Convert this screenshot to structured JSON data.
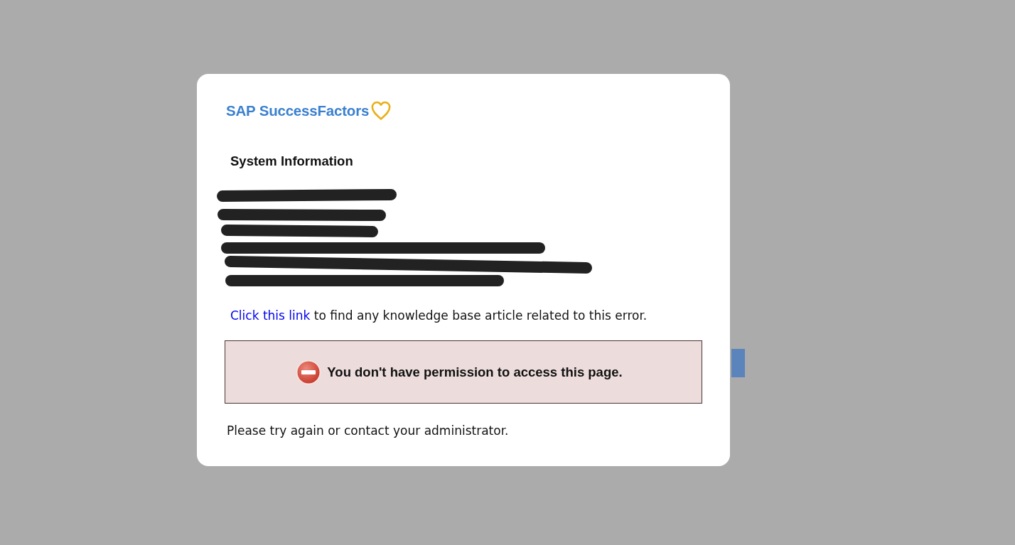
{
  "logo": {
    "text": "SAP SuccessFactors"
  },
  "system_information": {
    "title": "System Information"
  },
  "knowledge_base": {
    "link": "Click this link",
    "text": "to find any knowledge base article related to this error."
  },
  "alert": {
    "kind": "error",
    "message": "You don't have permission to access this page."
  },
  "footer": {
    "text": "Please try again or contact your administrator."
  }
}
